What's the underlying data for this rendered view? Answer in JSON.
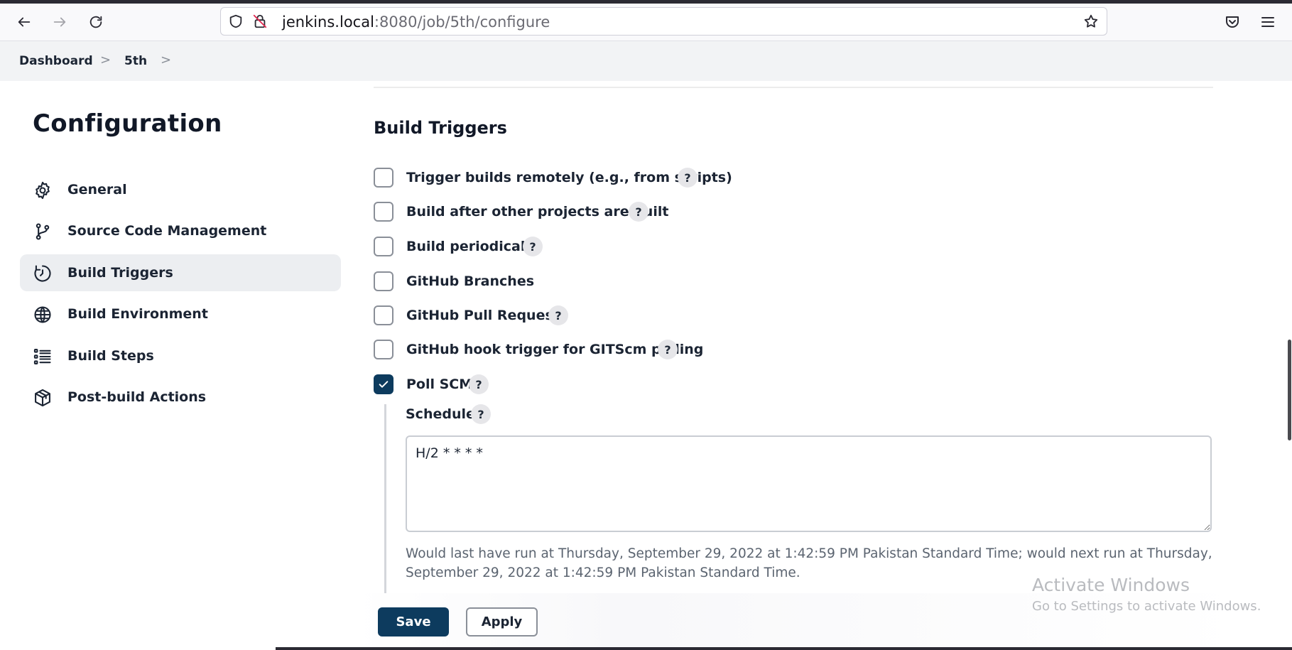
{
  "browser": {
    "url_host": "jenkins.local",
    "url_rest": ":8080/job/5th/configure"
  },
  "breadcrumb": {
    "items": [
      "Dashboard",
      "5th"
    ],
    "separator": ">"
  },
  "sidebar": {
    "title": "Configuration",
    "items": [
      {
        "label": "General",
        "icon": "gear-icon"
      },
      {
        "label": "Source Code Management",
        "icon": "git-branch-icon"
      },
      {
        "label": "Build Triggers",
        "icon": "timer-icon",
        "active": true
      },
      {
        "label": "Build Environment",
        "icon": "globe-icon"
      },
      {
        "label": "Build Steps",
        "icon": "list-icon"
      },
      {
        "label": "Post-build Actions",
        "icon": "package-icon"
      }
    ]
  },
  "build_triggers": {
    "heading": "Build Triggers",
    "options": [
      {
        "label": "Trigger builds remotely (e.g., from scripts)",
        "checked": false,
        "help": "?"
      },
      {
        "label": "Build after other projects are built",
        "checked": false,
        "help": "?"
      },
      {
        "label": "Build periodically",
        "checked": false,
        "help": "?"
      },
      {
        "label": "GitHub Branches",
        "checked": false
      },
      {
        "label": "GitHub Pull Requests",
        "checked": false,
        "help": "?"
      },
      {
        "label": "GitHub hook trigger for GITScm polling",
        "checked": false,
        "help": "?"
      },
      {
        "label": "Poll SCM",
        "checked": true,
        "help": "?"
      }
    ],
    "schedule": {
      "label": "Schedule",
      "help": "?",
      "value": "H/2 * * * *",
      "note": "Would last have run at Thursday, September 29, 2022 at 1:42:59 PM Pakistan Standard Time; would next run at Thursday, September 29, 2022 at 1:42:59 PM Pakistan Standard Time."
    }
  },
  "actions": {
    "save_label": "Save",
    "apply_label": "Apply"
  },
  "watermark": {
    "line1": "Activate Windows",
    "line2": "Go to Settings to activate Windows."
  },
  "colors": {
    "accent": "#0d3b5e",
    "active_nav_bg": "#eceef1"
  }
}
